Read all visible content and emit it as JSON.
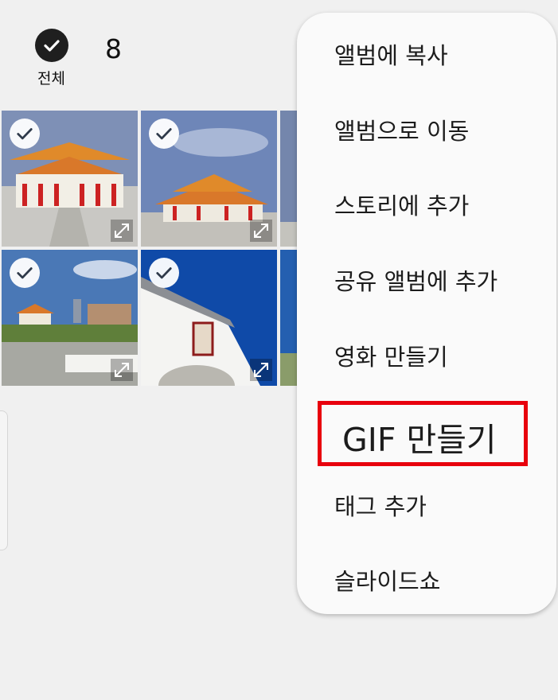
{
  "header": {
    "select_all_label": "전체",
    "selected_count": "8"
  },
  "photos": [
    {
      "name": "palace-front",
      "selected": true
    },
    {
      "name": "palace-side",
      "selected": true
    },
    {
      "name": "partial-top-right",
      "selected": true
    },
    {
      "name": "plaza-view",
      "selected": true
    },
    {
      "name": "gate-roof",
      "selected": true
    },
    {
      "name": "partial-bottom-right",
      "selected": true
    }
  ],
  "menu": {
    "items": [
      "앨범에 복사",
      "앨범으로 이동",
      "스토리에 추가",
      "공유 앨범에 추가",
      "영화 만들기",
      "GIF 만들기",
      "태그 추가",
      "슬라이드쇼"
    ],
    "highlighted_item": "GIF 만들기"
  },
  "colors": {
    "background": "#f0f0f0",
    "menu_background": "#fafafa",
    "highlight_border": "#e8000d",
    "check_badge": "#1f1f1f"
  }
}
